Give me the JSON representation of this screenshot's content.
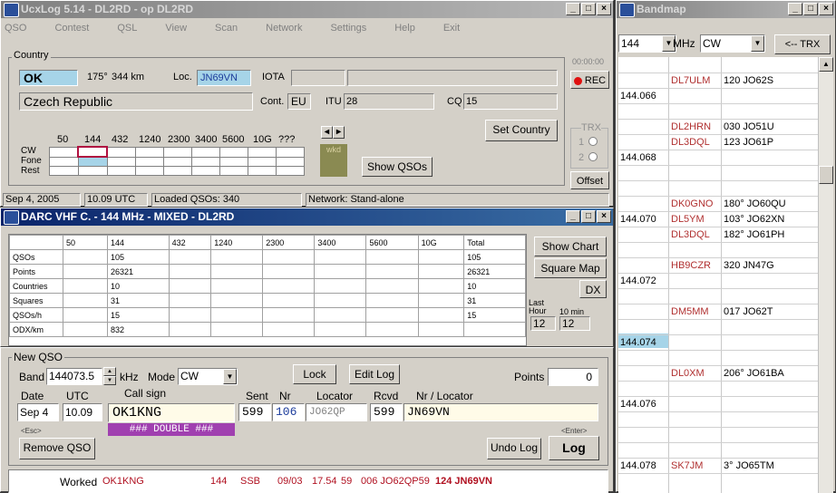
{
  "main": {
    "title": "UcxLog 5.14  - DL2RD  - op DL2RD",
    "menu": [
      "QSO",
      "Contest",
      "QSL",
      "View",
      "Scan",
      "Network",
      "Settings",
      "Help",
      "Exit"
    ],
    "country_frame": "Country",
    "prefix": "OK",
    "bearing": "175°",
    "distance": "344 km",
    "loc_label": "Loc.",
    "locator": "JN69VN",
    "iota_label": "IOTA",
    "timer": "00:00:00",
    "rec": "REC",
    "country_name": "Czech Republic",
    "cont_label": "Cont.",
    "cont": "EU",
    "itu_label": "ITU",
    "itu": "28",
    "cq_label": "CQ",
    "cq": "15",
    "set_country": "Set Country",
    "bands": [
      "50",
      "144",
      "432",
      "1240",
      "2300",
      "3400",
      "5600",
      "10G",
      "???"
    ],
    "modes": [
      "CW",
      "Fone",
      "Rest"
    ],
    "wkd": "wkd",
    "show_qsos": "Show QSOs",
    "trx_label": "TRX",
    "trx1": "1",
    "trx2": "2",
    "offset": "Offset",
    "status_date": "Sep 4, 2005",
    "status_time": "10.09 UTC",
    "status_loaded": "Loaded QSOs: 340",
    "status_network": "Network: Stand-alone"
  },
  "contest": {
    "title": "DARC VHF C.  - 144 MHz - MIXED  - DL2RD",
    "headers": [
      "",
      "50",
      "144",
      "432",
      "1240",
      "2300",
      "3400",
      "5600",
      "10G",
      "Total"
    ],
    "rows": [
      [
        "QSOs",
        "",
        "105",
        "",
        "",
        "",
        "",
        "",
        "",
        "105"
      ],
      [
        "Points",
        "",
        "26321",
        "",
        "",
        "",
        "",
        "",
        "",
        "26321"
      ],
      [
        "Countries",
        "",
        "10",
        "",
        "",
        "",
        "",
        "",
        "",
        "10"
      ],
      [
        "Squares",
        "",
        "31",
        "",
        "",
        "",
        "",
        "",
        "",
        "31"
      ],
      [
        "QSOs/h",
        "",
        "15",
        "",
        "",
        "",
        "",
        "",
        "",
        "15"
      ],
      [
        "ODX/km",
        "",
        "832",
        "",
        "",
        "",
        "",
        "",
        "",
        ""
      ]
    ],
    "show_chart": "Show Chart",
    "square_map": "Square Map",
    "dx": "DX",
    "last_hour": "Last Hour",
    "ten_min": "10 min",
    "last_hour_val": "12",
    "ten_min_val": "12"
  },
  "newqso": {
    "frame": "New QSO",
    "band_label": "Band",
    "band": "144073.5",
    "khz": "kHz",
    "mode_label": "Mode",
    "mode": "CW",
    "lock": "Lock",
    "edit_log": "Edit Log",
    "points_label": "Points",
    "points": "0",
    "date_label": "Date",
    "utc_label": "UTC",
    "call_label": "Call sign",
    "sent_label": "Sent",
    "nr_label": "Nr",
    "locator_label": "Locator",
    "rcvd_label": "Rcvd",
    "nrloc_label": "Nr / Locator",
    "date": "Sep 4",
    "utc": "10.09",
    "call": "OK1KNG",
    "sent": "599",
    "nr": "106",
    "sent_loc": "JO62QP",
    "rcvd": "599",
    "rcvd_nrloc": "JN69VN",
    "double": "### DOUBLE ###",
    "esc": "<Esc>",
    "enter": "<Enter>",
    "remove": "Remove QSO",
    "undo": "Undo Log",
    "log": "Log",
    "worked_label": "Worked",
    "worked_call": "OK1KNG",
    "worked_band": "144",
    "worked_mode": "SSB",
    "worked_date": "09/03",
    "worked_time": "17.54",
    "worked_rst": "59",
    "worked_nr_loc": "006 JO62QP59",
    "worked_rcvd": "124 JN69VN"
  },
  "bandmap": {
    "title": "Bandmap",
    "band": "144",
    "mhz": "MHz",
    "mode": "CW",
    "trx_btn": "<-- TRX",
    "rows": [
      {
        "freq": "",
        "call": "",
        "info": ""
      },
      {
        "freq": "",
        "call": "DL7ULM",
        "info": "120 JO62S"
      },
      {
        "freq": "144.066",
        "call": "",
        "info": ""
      },
      {
        "freq": "",
        "call": "",
        "info": ""
      },
      {
        "freq": "",
        "call": "DL2HRN",
        "info": "030 JO51U"
      },
      {
        "freq": "",
        "call": "DL3DQL",
        "info": "123 JO61P"
      },
      {
        "freq": "144.068",
        "call": "",
        "info": ""
      },
      {
        "freq": "",
        "call": "",
        "info": ""
      },
      {
        "freq": "",
        "call": "",
        "info": ""
      },
      {
        "freq": "",
        "call": "DK0GNO",
        "info": "180°  JO60QU"
      },
      {
        "freq": "144.070",
        "call": "DL5YM",
        "info": "103°  JO62XN"
      },
      {
        "freq": "",
        "call": "DL3DQL",
        "info": "182°  JO61PH"
      },
      {
        "freq": "",
        "call": "",
        "info": ""
      },
      {
        "freq": "",
        "call": "HB9CZR",
        "info": "320 JN47G"
      },
      {
        "freq": "144.072",
        "call": "",
        "info": ""
      },
      {
        "freq": "",
        "call": "",
        "info": ""
      },
      {
        "freq": "",
        "call": "DM5MM",
        "info": "017 JO62T"
      },
      {
        "freq": "",
        "call": "",
        "info": ""
      },
      {
        "freq": "144.074",
        "call": "",
        "info": ""
      },
      {
        "freq": "",
        "call": "",
        "info": ""
      },
      {
        "freq": "",
        "call": "DL0XM",
        "info": "206°  JO61BA"
      },
      {
        "freq": "",
        "call": "",
        "info": ""
      },
      {
        "freq": "144.076",
        "call": "",
        "info": ""
      },
      {
        "freq": "",
        "call": "",
        "info": ""
      },
      {
        "freq": "",
        "call": "",
        "info": ""
      },
      {
        "freq": "",
        "call": "",
        "info": ""
      },
      {
        "freq": "144.078",
        "call": "SK7JM",
        "info": "3°   JO65TM"
      }
    ]
  }
}
